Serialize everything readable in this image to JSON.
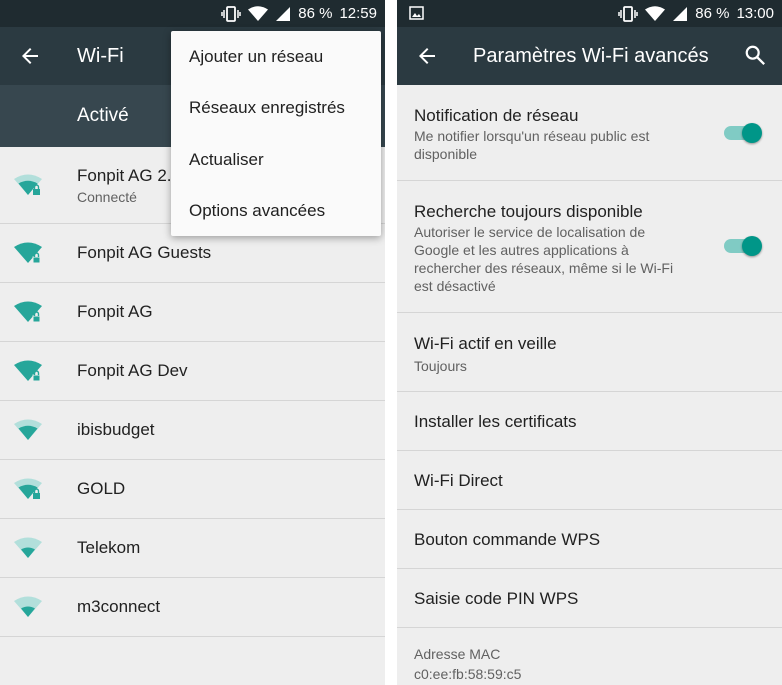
{
  "left": {
    "status": {
      "battery": "86 %",
      "time": "12:59"
    },
    "appbar": {
      "title": "Wi-Fi"
    },
    "subbar": {
      "label": "Activé"
    },
    "networks": [
      {
        "name": "Fonpit AG 2.",
        "status": "Connecté",
        "signal": "medium",
        "locked": true
      },
      {
        "name": "Fonpit AG Guests",
        "signal": "full",
        "locked": true
      },
      {
        "name": "Fonpit AG",
        "signal": "full",
        "locked": true
      },
      {
        "name": "Fonpit AG Dev",
        "signal": "full",
        "locked": true
      },
      {
        "name": "ibisbudget",
        "signal": "medium",
        "locked": false
      },
      {
        "name": "GOLD",
        "signal": "medium",
        "locked": true
      },
      {
        "name": "Telekom",
        "signal": "low",
        "locked": false
      },
      {
        "name": "m3connect",
        "signal": "low",
        "locked": false
      }
    ],
    "menu": [
      "Ajouter un réseau",
      "Réseaux enregistrés",
      "Actualiser",
      "Options avancées"
    ]
  },
  "right": {
    "status": {
      "battery": "86 %",
      "time": "13:00"
    },
    "appbar": {
      "title": "Paramètres Wi-Fi avancés"
    },
    "settings": {
      "notification": {
        "title": "Notification de réseau",
        "summary": "Me notifier lorsqu'un réseau public est disponible",
        "enabled": true
      },
      "scanning": {
        "title": "Recherche toujours disponible",
        "summary": "Autoriser le service de localisation de Google et les autres applications à rechercher des réseaux, même si le Wi-Fi est désactivé",
        "enabled": true
      },
      "sleep": {
        "title": "Wi-Fi actif en veille",
        "summary": "Toujours"
      },
      "certs": {
        "title": "Installer les certificats"
      },
      "direct": {
        "title": "Wi-Fi Direct"
      },
      "wps_button": {
        "title": "Bouton commande WPS"
      },
      "wps_pin": {
        "title": "Saisie code PIN WPS"
      },
      "mac": {
        "label": "Adresse MAC",
        "value": "c0:ee:fb:58:59:c5"
      }
    }
  },
  "colors": {
    "accent": "#009688",
    "statusbar": "#1f2b30",
    "appbar": "#2b3a41",
    "subbar": "#37474f",
    "background": "#eeeeee"
  }
}
